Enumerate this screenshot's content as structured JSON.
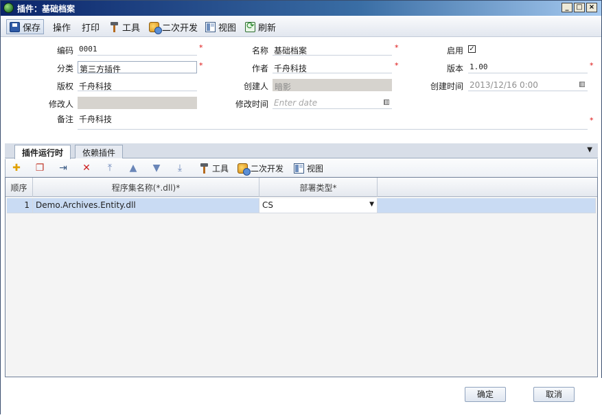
{
  "window": {
    "title": "插件：基础档案",
    "btn_min": "_",
    "btn_max": "□",
    "btn_close": "×"
  },
  "toolbar": {
    "save": "保存",
    "operate": "操作",
    "print": "打印",
    "tools": "工具",
    "dev": "二次开发",
    "view": "视图",
    "refresh": "刷新"
  },
  "form": {
    "code": {
      "label": "编码",
      "value": "0001"
    },
    "name": {
      "label": "名称",
      "value": "基础档案"
    },
    "enabled": {
      "label": "启用",
      "checked": true,
      "mark": "✓"
    },
    "category": {
      "label": "分类",
      "value": "第三方插件"
    },
    "author": {
      "label": "作者",
      "value": "千舟科技"
    },
    "version": {
      "label": "版本",
      "value": "1.00"
    },
    "copyright": {
      "label": "版权",
      "value": "千舟科技"
    },
    "creator": {
      "label": "创建人",
      "value": "暗影"
    },
    "created_time": {
      "label": "创建时间",
      "value": "2013/12/16 0:00"
    },
    "modifier": {
      "label": "修改人",
      "value": ""
    },
    "modified_time": {
      "label": "修改时间",
      "placeholder": "Enter date"
    },
    "remark": {
      "label": "备注",
      "value": "千舟科技"
    },
    "required_mark": "*"
  },
  "tabs": [
    {
      "label": "插件运行时",
      "active": true
    },
    {
      "label": "依赖插件",
      "active": false
    }
  ],
  "tab_menu": "▼",
  "grid_toolbar": {
    "tools": "工具",
    "dev": "二次开发",
    "view": "视图"
  },
  "grid": {
    "columns": [
      "顺序",
      "程序集名称(*.dll)*",
      "部署类型*",
      ""
    ],
    "rows": [
      {
        "order": "1",
        "assembly": "Demo.Archives.Entity.dll",
        "deploy": "CS"
      }
    ]
  },
  "footer": {
    "ok": "确定",
    "cancel": "取消"
  }
}
